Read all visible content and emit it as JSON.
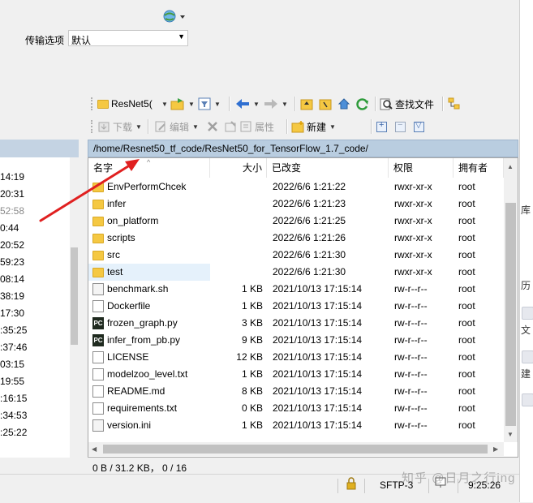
{
  "top": {
    "transfer_label": "传输选项",
    "transfer_value": "默认"
  },
  "toolbar1": {
    "folder_dropdown": "ResNet5(",
    "find_files": "查找文件"
  },
  "toolbar2": {
    "download": "下载",
    "edit": "编辑",
    "properties": "属性",
    "new": "新建"
  },
  "left_panel": {
    "times": [
      "14:19",
      "20:31",
      "52:58",
      "0:44",
      "20:52",
      "59:23",
      "08:14",
      "38:19",
      "17:30",
      ":35:25",
      ":37:46",
      "03:15",
      "19:55",
      ":16:15",
      ":34:53",
      ":25:22"
    ]
  },
  "right_panel": {
    "path": "/home/Resnet50_tf_code/ResNet50_for_TensorFlow_1.7_code/",
    "columns": {
      "name": "名字",
      "size": "大小",
      "modified": "已改变",
      "permissions": "权限",
      "owner": "拥有者"
    },
    "files": [
      {
        "name": "EnvPerformChcek",
        "size": "",
        "modified": "2022/6/6 1:21:22",
        "permissions": "rwxr-xr-x",
        "owner": "root",
        "type": "folder"
      },
      {
        "name": "infer",
        "size": "",
        "modified": "2022/6/6 1:21:23",
        "permissions": "rwxr-xr-x",
        "owner": "root",
        "type": "folder"
      },
      {
        "name": "on_platform",
        "size": "",
        "modified": "2022/6/6 1:21:25",
        "permissions": "rwxr-xr-x",
        "owner": "root",
        "type": "folder"
      },
      {
        "name": "scripts",
        "size": "",
        "modified": "2022/6/6 1:21:26",
        "permissions": "rwxr-xr-x",
        "owner": "root",
        "type": "folder"
      },
      {
        "name": "src",
        "size": "",
        "modified": "2022/6/6 1:21:30",
        "permissions": "rwxr-xr-x",
        "owner": "root",
        "type": "folder"
      },
      {
        "name": "test",
        "size": "",
        "modified": "2022/6/6 1:21:30",
        "permissions": "rwxr-xr-x",
        "owner": "root",
        "type": "folder"
      },
      {
        "name": "benchmark.sh",
        "size": "1 KB",
        "modified": "2021/10/13 17:15:14",
        "permissions": "rw-r--r--",
        "owner": "root",
        "type": "script"
      },
      {
        "name": "Dockerfile",
        "size": "1 KB",
        "modified": "2021/10/13 17:15:14",
        "permissions": "rw-r--r--",
        "owner": "root",
        "type": "doc"
      },
      {
        "name": "frozen_graph.py",
        "size": "3 KB",
        "modified": "2021/10/13 17:15:14",
        "permissions": "rw-r--r--",
        "owner": "root",
        "type": "py"
      },
      {
        "name": "infer_from_pb.py",
        "size": "9 KB",
        "modified": "2021/10/13 17:15:14",
        "permissions": "rw-r--r--",
        "owner": "root",
        "type": "py"
      },
      {
        "name": "LICENSE",
        "size": "12 KB",
        "modified": "2021/10/13 17:15:14",
        "permissions": "rw-r--r--",
        "owner": "root",
        "type": "doc"
      },
      {
        "name": "modelzoo_level.txt",
        "size": "1 KB",
        "modified": "2021/10/13 17:15:14",
        "permissions": "rw-r--r--",
        "owner": "root",
        "type": "doc"
      },
      {
        "name": "README.md",
        "size": "8 KB",
        "modified": "2021/10/13 17:15:14",
        "permissions": "rw-r--r--",
        "owner": "root",
        "type": "doc"
      },
      {
        "name": "requirements.txt",
        "size": "0 KB",
        "modified": "2021/10/13 17:15:14",
        "permissions": "rw-r--r--",
        "owner": "root",
        "type": "doc"
      },
      {
        "name": "version.ini",
        "size": "1 KB",
        "modified": "2021/10/13 17:15:14",
        "permissions": "rw-r--r--",
        "owner": "root",
        "type": "script"
      }
    ],
    "status": "0 B / 31.2 KB，  0 / 16"
  },
  "bottom_bar": {
    "protocol": "SFTP-3",
    "time": "9:25:26"
  },
  "right_strip": {
    "c1": "库",
    "c2": "历",
    "c3": "文",
    "c4": "建"
  },
  "watermark": "知乎 @日月之行ing",
  "colors": {
    "path_bar": "#b9cde0",
    "selection": "#e5f1fb",
    "arrow": "#e02020"
  }
}
